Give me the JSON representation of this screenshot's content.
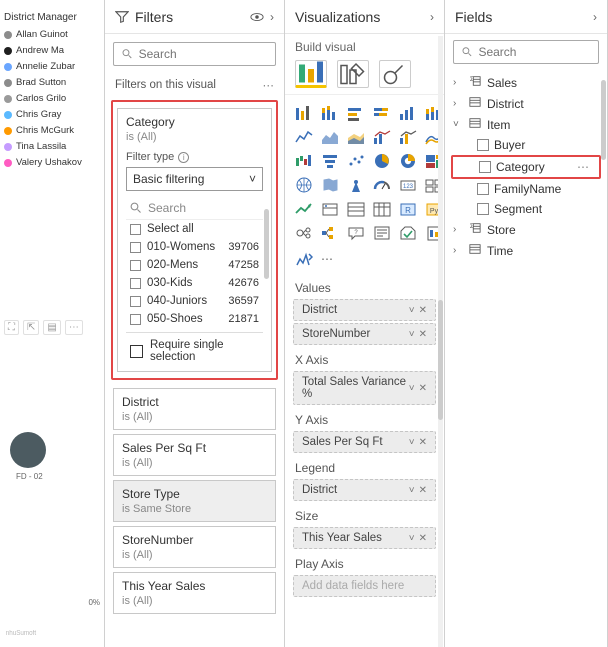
{
  "canvas": {
    "dm_title": "District Manager",
    "managers": [
      {
        "name": "Allan Guinot",
        "color": "#8c8c8c"
      },
      {
        "name": "Andrew Ma",
        "color": "#1f1f1f"
      },
      {
        "name": "Annelie Zubar",
        "color": "#6aa6ff"
      },
      {
        "name": "Brad Sutton",
        "color": "#8c8c8c"
      },
      {
        "name": "Carlos Grilo",
        "color": "#9a9a9a"
      },
      {
        "name": "Chris Gray",
        "color": "#5ab9ff"
      },
      {
        "name": "Chris McGurk",
        "color": "#ff9a00"
      },
      {
        "name": "Tina Lassila",
        "color": "#c59cff"
      },
      {
        "name": "Valery Ushakov",
        "color": "#ff5cc2"
      }
    ],
    "fd_label": "FD - 02",
    "pct_label": "0%",
    "faint": "nhuSumoft"
  },
  "filters": {
    "title": "Filters",
    "search_placeholder": "Search",
    "section_label": "Filters on this visual",
    "category_card": {
      "name": "Category",
      "cond": "is (All)",
      "filter_type_label": "Filter type",
      "filter_type_value": "Basic filtering",
      "inner_search": "Search",
      "options": [
        {
          "label": "Select all",
          "count": ""
        },
        {
          "label": "010-Womens",
          "count": "39706"
        },
        {
          "label": "020-Mens",
          "count": "47258"
        },
        {
          "label": "030-Kids",
          "count": "42676"
        },
        {
          "label": "040-Juniors",
          "count": "36597"
        },
        {
          "label": "050-Shoes",
          "count": "21871"
        }
      ],
      "require_single": "Require single selection"
    },
    "cards": [
      {
        "name": "District",
        "cond": "is (All)"
      },
      {
        "name": "Sales Per Sq Ft",
        "cond": "is (All)"
      },
      {
        "name": "Store Type",
        "cond": "is Same Store",
        "emph": true
      },
      {
        "name": "StoreNumber",
        "cond": "is (All)"
      },
      {
        "name": "This Year Sales",
        "cond": "is (All)"
      }
    ]
  },
  "viz": {
    "title": "Visualizations",
    "build_label": "Build visual",
    "wells": [
      {
        "title": "Values",
        "items": [
          {
            "label": "District"
          },
          {
            "label": "StoreNumber"
          }
        ]
      },
      {
        "title": "X Axis",
        "items": [
          {
            "label": "Total Sales Variance %"
          }
        ]
      },
      {
        "title": "Y Axis",
        "items": [
          {
            "label": "Sales Per Sq Ft"
          }
        ]
      },
      {
        "title": "Legend",
        "items": [
          {
            "label": "District"
          }
        ]
      },
      {
        "title": "Size",
        "items": [
          {
            "label": "This Year Sales"
          }
        ]
      },
      {
        "title": "Play Axis",
        "items": [
          {
            "label": "Add data fields here",
            "ghost": true
          }
        ]
      }
    ]
  },
  "fields": {
    "title": "Fields",
    "search_placeholder": "Search",
    "tables": [
      {
        "name": "Sales",
        "open": false,
        "has_sum": true
      },
      {
        "name": "District",
        "open": false
      },
      {
        "name": "Item",
        "open": true,
        "children": [
          {
            "name": "Buyer"
          },
          {
            "name": "Category",
            "highlight": true
          },
          {
            "name": "FamilyName"
          },
          {
            "name": "Segment"
          }
        ]
      },
      {
        "name": "Store",
        "open": false,
        "has_sum": true
      },
      {
        "name": "Time",
        "open": false
      }
    ]
  }
}
